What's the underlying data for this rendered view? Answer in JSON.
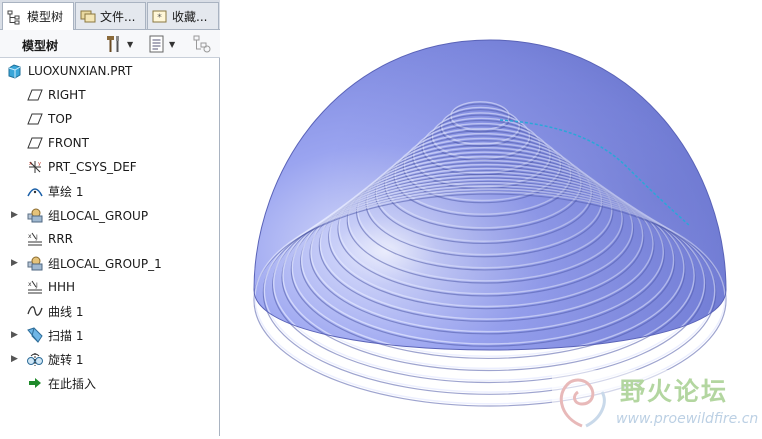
{
  "tabs": [
    {
      "label": "模型树",
      "icon": "tree-icon",
      "active": true
    },
    {
      "label": "文件...",
      "icon": "folder-icon",
      "active": false
    },
    {
      "label": "收藏...",
      "icon": "favorites-icon",
      "active": false
    }
  ],
  "toolbar": {
    "title": "模型树",
    "settings_icon": "tools-icon",
    "view_icon": "list-view-icon",
    "filter_icon": "filter-icon"
  },
  "tree": {
    "root": {
      "label": "LUOXUNXIAN.PRT",
      "icon": "part-icon"
    },
    "items": [
      {
        "label": "RIGHT",
        "icon": "datum-plane-icon",
        "expandable": false
      },
      {
        "label": "TOP",
        "icon": "datum-plane-icon",
        "expandable": false
      },
      {
        "label": "FRONT",
        "icon": "datum-plane-icon",
        "expandable": false
      },
      {
        "label": "PRT_CSYS_DEF",
        "icon": "csys-icon",
        "expandable": false
      },
      {
        "label": "草绘 1",
        "icon": "sketch-icon",
        "expandable": false
      },
      {
        "label": "组LOCAL_GROUP",
        "icon": "group-icon",
        "expandable": true
      },
      {
        "label": "RRR",
        "icon": "parameter-icon",
        "expandable": false
      },
      {
        "label": "组LOCAL_GROUP_1",
        "icon": "group-icon",
        "expandable": true
      },
      {
        "label": "HHH",
        "icon": "parameter-icon",
        "expandable": false
      },
      {
        "label": "曲线 1",
        "icon": "curve-icon",
        "expandable": false
      },
      {
        "label": "扫描 1",
        "icon": "sweep-icon",
        "expandable": true
      },
      {
        "label": "旋转 1",
        "icon": "revolve-icon",
        "expandable": true
      },
      {
        "label": "在此插入",
        "icon": "insert-here-icon",
        "expandable": false
      }
    ]
  },
  "watermark": {
    "title": "野火论坛",
    "url": "www.proewildfire.cn"
  },
  "colors": {
    "model": "#8c97ee",
    "accent_line": "#2aa7d8",
    "panel_border": "#a9b3c1"
  }
}
